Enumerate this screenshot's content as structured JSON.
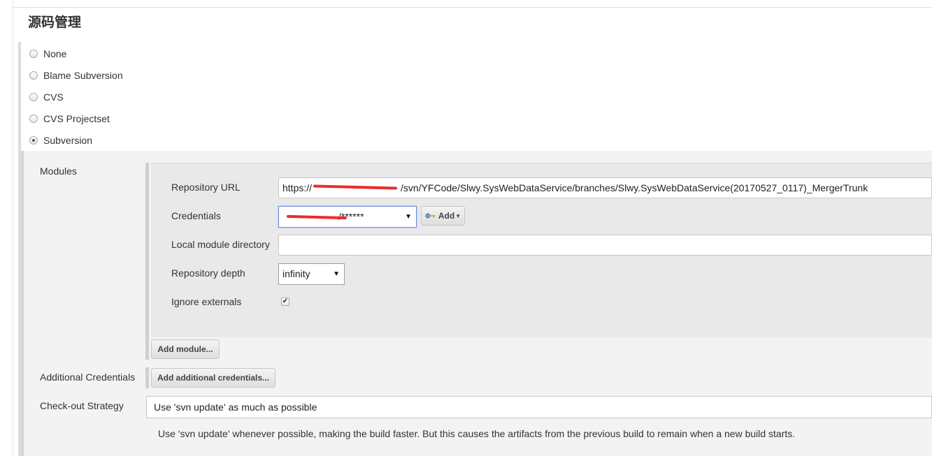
{
  "section": {
    "title": "源码管理"
  },
  "scm_options": [
    {
      "label": "None",
      "selected": false
    },
    {
      "label": "Blame Subversion",
      "selected": false
    },
    {
      "label": "CVS",
      "selected": false
    },
    {
      "label": "CVS Projectset",
      "selected": false
    },
    {
      "label": "Subversion",
      "selected": true
    }
  ],
  "subversion": {
    "modules_label": "Modules",
    "module": {
      "repository_url_label": "Repository URL",
      "repository_url_prefix": "https://",
      "repository_url_suffix": "/svn/YFCode/Slwy.SysWebDataService/branches/Slwy.SysWebDataService(20170527_0117)_MergerTrunk",
      "credentials_label": "Credentials",
      "credentials_value": "/******",
      "add_button_label": "Add",
      "local_module_directory_label": "Local module directory",
      "local_module_directory_value": "",
      "repository_depth_label": "Repository depth",
      "repository_depth_value": "infinity",
      "ignore_externals_label": "Ignore externals",
      "ignore_externals_checked": true
    },
    "add_module_button": "Add module...",
    "additional_credentials_label": "Additional Credentials",
    "add_additional_credentials_button": "Add additional credentials...",
    "checkout_strategy_label": "Check-out Strategy",
    "checkout_strategy_value": "Use 'svn update' as much as possible",
    "checkout_strategy_help": "Use 'svn update' whenever possible, making the build faster. But this causes the artifacts from the previous build to remain when a new build starts."
  },
  "colors": {
    "redaction": "#ec2a2a",
    "focus_border": "#6b8fd6",
    "panel_bg": "#f3f3f3",
    "module_bg": "#e9e9e9"
  },
  "icons": {
    "key": "key-icon",
    "dropdown": "chevron-down-icon",
    "checkmark": "checkmark-icon"
  }
}
